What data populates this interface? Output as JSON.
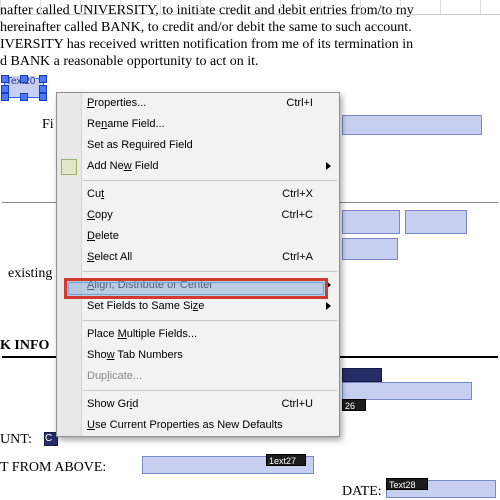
{
  "doc": {
    "line1": "nafter called UNIVERSITY, to initiate credit and debit entries from/to my",
    "line2": "hereinafter called BANK, to credit and/or debit the same to such account.",
    "line3": "IVERSITY has received written notification from me of its termination in",
    "line4": "d BANK a reasonable opportunity to act on it."
  },
  "labels": {
    "fi_partial": "Fi",
    "existing": "existing",
    "k_info": "K INFO",
    "unt": "UNT:",
    "from_above": "T FROM ABOVE:",
    "date": "DATE:"
  },
  "fields": {
    "selected": "Text20",
    "f26": "26",
    "f1ext": "1ext27",
    "text28": "Text28",
    "dark1": "C"
  },
  "menu": {
    "properties": "Properties...",
    "properties_sc": "Ctrl+I",
    "rename": "Rename Field...",
    "required": "Set as Required Field",
    "addnew": "Add New Field",
    "cut": "Cut",
    "cut_sc": "Ctrl+X",
    "copy": "Copy",
    "copy_sc": "Ctrl+C",
    "delete": "Delete",
    "selectall": "Select All",
    "selectall_sc": "Ctrl+A",
    "align": "Align, Distribute or Center",
    "samesize": "Set Fields to Same Size",
    "multiple": "Place Multiple Fields...",
    "tabnumbers": "Show Tab Numbers",
    "duplicate": "Duplicate...",
    "showgrid": "Show Grid",
    "showgrid_sc": "Ctrl+U",
    "defaults": "Use Current Properties as New Defaults"
  }
}
